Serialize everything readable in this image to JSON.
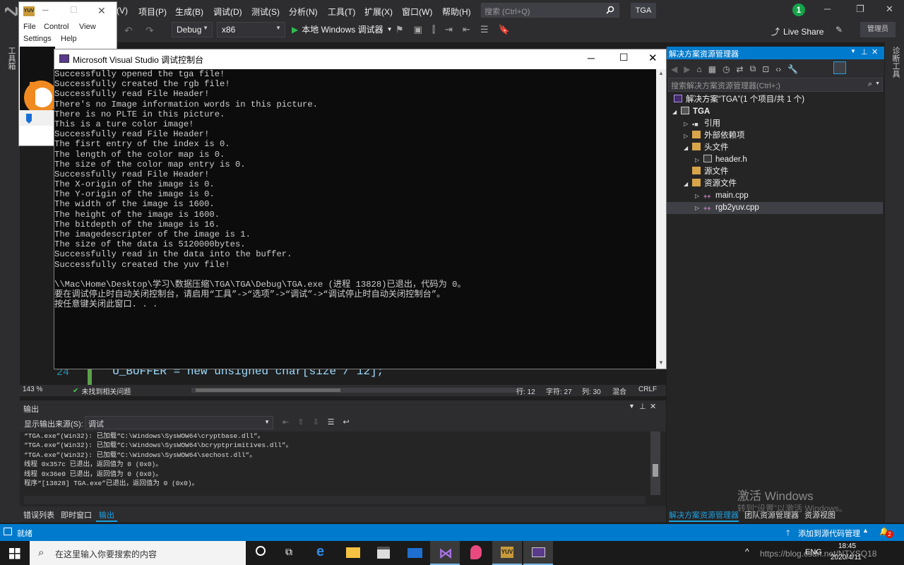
{
  "vs": {
    "menu": [
      "(V)",
      "项目(P)",
      "生成(B)",
      "调试(D)",
      "测试(S)",
      "分析(N)",
      "工具(T)",
      "扩展(X)",
      "窗口(W)",
      "帮助(H)"
    ],
    "search_placeholder": "搜索 (Ctrl+Q)",
    "solution_badge": "TGA",
    "notifications": "1",
    "config": "Debug",
    "platform": "x86",
    "run_label": "本地 Windows 调试器",
    "live_share": "Live Share",
    "admin": "管理员",
    "left_vertical": "工具箱",
    "right_vertical": "诊断工具"
  },
  "tga_window": {
    "app_icon_text": "YUV",
    "menu": [
      "File",
      "Control",
      "View",
      "Settings",
      "Help"
    ]
  },
  "console": {
    "title": "Microsoft Visual Studio 调试控制台",
    "lines": [
      "Successfully opened the tga file!",
      "Successfully created the rgb file!",
      "Successfully read File Header!",
      "There's no Image information words in this picture.",
      "There is no PLTE in this picture.",
      "This is a ture color image!",
      "Successfully read File Header!",
      "The fisrt entry of the index is 0.",
      "The length of the color map is 0.",
      "The size of the color map entry is 0.",
      "Successfully read File Header!",
      "The X-origin of the image is 0.",
      "The Y-origin of the image is 0.",
      "The width of the image is 1600.",
      "The height of the image is 1600.",
      "The bitdepth of the image is 16.",
      "The imagedescripter of the image is 1.",
      "The size of the data is 5120000bytes.",
      "Successfully read in the data into the buffer.",
      "Successfully created the yuv file!",
      "",
      "\\\\Mac\\Home\\Desktop\\学习\\数据压缩\\TGA\\TGA\\Debug\\TGA.exe (进程 13828)已退出，代码为 0。",
      "要在调试停止时自动关闭控制台，请启用“工具”->“选项”->“调试”->“调试停止时自动关闭控制台”。",
      "按任意键关闭此窗口. . ."
    ]
  },
  "editor": {
    "line_number": "24",
    "code_text": "  U_BUFFER = new unsigned char[size / 12];",
    "zoom": "143 %",
    "no_issues": "未找到相关问题",
    "line": "行: 12",
    "char": "字符: 27",
    "col": "列: 30",
    "mixed": "混合",
    "eol": "CRLF"
  },
  "output": {
    "title": "输出",
    "source_label": "显示输出来源(S):",
    "source_value": "调试",
    "lines": [
      "“TGA.exe”(Win32): 已加载“C:\\Windows\\SysWOW64\\cryptbase.dll”。",
      "“TGA.exe”(Win32): 已加载“C:\\Windows\\SysWOW64\\bcryptprimitives.dll”。",
      "“TGA.exe”(Win32): 已加载“C:\\Windows\\SysWOW64\\sechost.dll”。",
      "线程 0x357c 已退出，返回值为 0 (0x0)。",
      "线程 0x36e0 已退出，返回值为 0 (0x0)。",
      "程序“[13828] TGA.exe”已退出，返回值为 0 (0x0)。"
    ],
    "tabs": [
      "错误列表",
      "即时窗口",
      "输出"
    ]
  },
  "solution_explorer": {
    "title": "解决方案资源管理器",
    "search_placeholder": "搜索解决方案资源管理器(Ctrl+;)",
    "tree": [
      {
        "label": "解决方案“TGA”(1 个项目/共 1 个)",
        "depth": 0,
        "arrow": ""
      },
      {
        "label": "TGA",
        "depth": 1,
        "arrow": "◢"
      },
      {
        "label": "引用",
        "depth": 2,
        "arrow": "▷"
      },
      {
        "label": "外部依赖项",
        "depth": 2,
        "arrow": "▷"
      },
      {
        "label": "头文件",
        "depth": 2,
        "arrow": "◢"
      },
      {
        "label": "header.h",
        "depth": 3,
        "arrow": "▷"
      },
      {
        "label": "源文件",
        "depth": 2,
        "arrow": ""
      },
      {
        "label": "资源文件",
        "depth": 2,
        "arrow": "◢"
      },
      {
        "label": "main.cpp",
        "depth": 3,
        "arrow": "▷"
      },
      {
        "label": "rgb2yuv.cpp",
        "depth": 3,
        "arrow": "▷"
      }
    ],
    "tabs": [
      "解决方案资源管理器",
      "团队资源管理器",
      "资源视图"
    ],
    "activate_title": "激活 Windows",
    "activate_sub": "转到“设置”以激活 Windows。"
  },
  "statusbar": {
    "ready": "就绪",
    "add_source": "添加到源代码管理",
    "badge": "2"
  },
  "taskbar": {
    "search_placeholder": "在这里输入你要搜索的内容",
    "lang": "ENG",
    "time": "18:45",
    "date": "2020/4/11",
    "watermark": "https://blog.csdn.net/NTYSQ18"
  }
}
